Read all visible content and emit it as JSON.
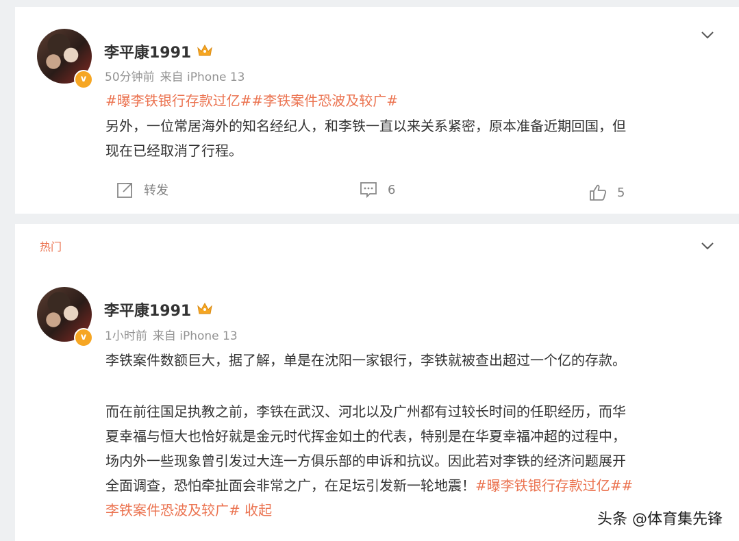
{
  "post1": {
    "username": "李平康1991",
    "time": "50分钟前",
    "source": "来自 iPhone 13",
    "tags": "#曝李铁银行存款过亿##李铁案件恐波及较广#",
    "text_line1": "另外，一位常居海外的知名经纪人，和李铁一直以来关系紧密，原本准备近期回国，但",
    "text_line2": "现在已经取消了行程。",
    "repost_label": "转发",
    "comment_count": "6",
    "like_count": "5"
  },
  "post2": {
    "section_label": "热门",
    "username": "李平康1991",
    "time": "1小时前",
    "source": "来自 iPhone 13",
    "para1": "李铁案件数额巨大，据了解，单是在沈阳一家银行，李铁就被查出超过一个亿的存款。",
    "para2_line1": "而在前往国足执教之前，李铁在武汉、河北以及广州都有过较长时间的任职经历，而华",
    "para2_line2": "夏幸福与恒大也恰好就是金元时代挥金如土的代表，特别是在华夏幸福冲超的过程中，",
    "para2_line3": "场内外一些现象曾引发过大连一方俱乐部的申诉和抗议。因此若对李铁的经济问题展开",
    "para2_line4": "全面调查，恐怕牵扯面会非常之广，在足坛引发新一轮地震！",
    "tag1": "#曝李铁银行存款过亿##",
    "tag2": "李铁案件恐波及较广#",
    "collapse_label": "收起"
  },
  "watermark": "头条 @体育集先锋",
  "colors": {
    "accent": "#eb7350",
    "verified": "#f6a623",
    "meta": "#939393",
    "background": "#eef0f2"
  },
  "icons": [
    "crown-icon",
    "verified-badge-icon",
    "chevron-down-icon",
    "repost-icon",
    "comment-icon",
    "like-icon"
  ]
}
